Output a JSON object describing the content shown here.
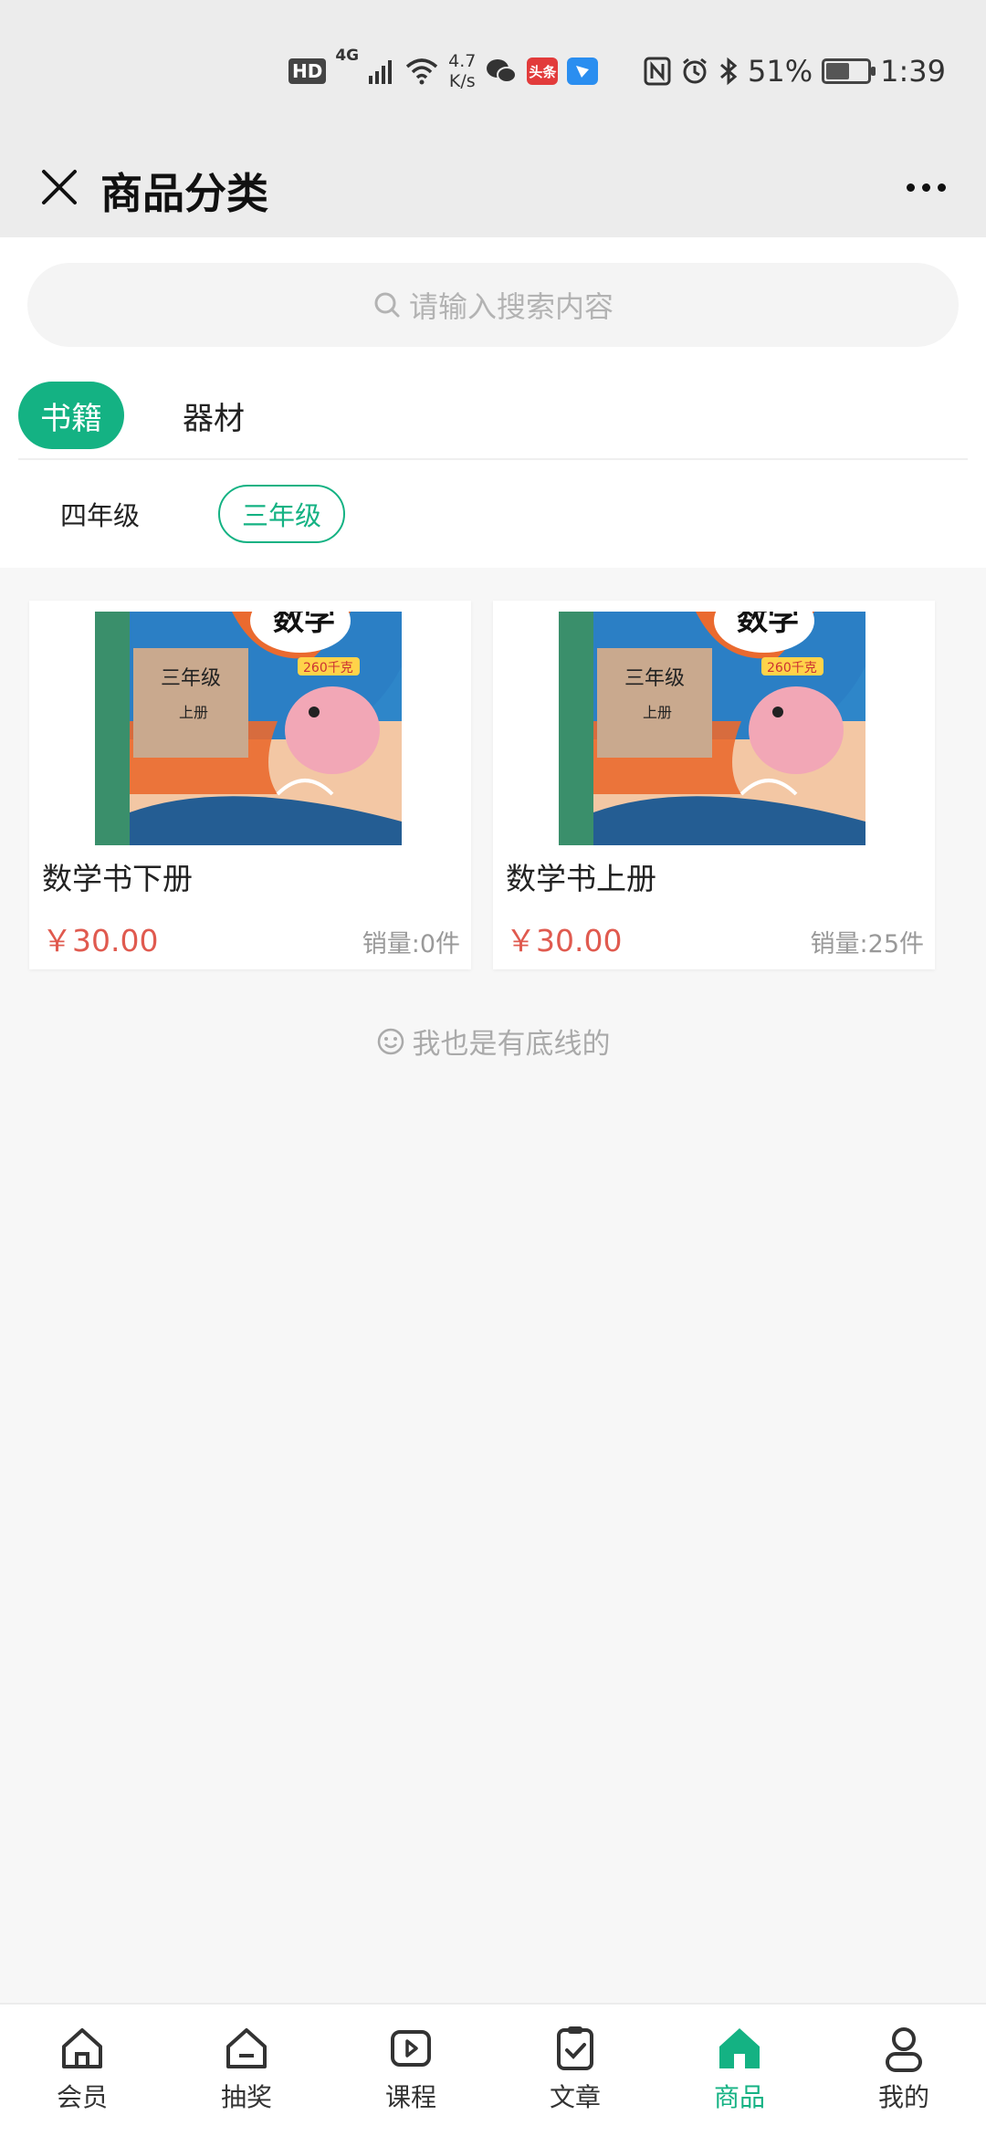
{
  "status_bar": {
    "hd": "HD",
    "network": "4G",
    "speed_value": "4.7",
    "speed_unit": "K/s",
    "toutiao_badge": "头条",
    "battery": "51%",
    "time": "1:39"
  },
  "nav": {
    "title": "商品分类",
    "icons": [
      "close-icon",
      "more-icon"
    ]
  },
  "search": {
    "placeholder": "请输入搜索内容"
  },
  "categories": {
    "tabs": [
      {
        "label": "书籍",
        "active": true
      },
      {
        "label": "器材",
        "active": false
      }
    ],
    "sub_tabs": [
      {
        "label": "四年级",
        "active": false
      },
      {
        "label": "三年级",
        "active": true
      }
    ]
  },
  "cover": {
    "title_char": "数学",
    "grade": "三年级",
    "volume": "上册",
    "badge": "260千克"
  },
  "products": [
    {
      "name": "数学书下册",
      "price": "￥30.00",
      "sales": "销量:0件"
    },
    {
      "name": "数学书上册",
      "price": "￥30.00",
      "sales": "销量:25件"
    }
  ],
  "bottom_line": {
    "text": "我也是有底线的"
  },
  "tab_bar": {
    "items": [
      {
        "label": "会员",
        "icon": "home-outline-icon"
      },
      {
        "label": "抽奖",
        "icon": "lottery-icon"
      },
      {
        "label": "课程",
        "icon": "play-icon"
      },
      {
        "label": "文章",
        "icon": "clipboard-check-icon"
      },
      {
        "label": "商品",
        "icon": "home-filled-icon",
        "active": true
      },
      {
        "label": "我的",
        "icon": "user-icon"
      }
    ]
  },
  "colors": {
    "accent": "#14b283",
    "price": "#e05a4f"
  }
}
